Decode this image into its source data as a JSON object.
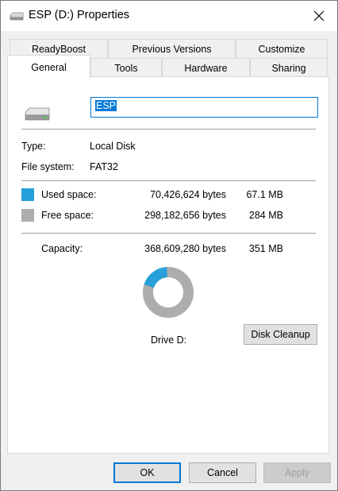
{
  "window": {
    "title": "ESP (D:) Properties"
  },
  "tabs_top": [
    "ReadyBoost",
    "Previous Versions",
    "Customize"
  ],
  "tabs_bottom": [
    "General",
    "Tools",
    "Hardware",
    "Sharing"
  ],
  "active_tab": "General",
  "drive": {
    "name": "ESP",
    "type_label": "Type:",
    "type_value": "Local Disk",
    "fs_label": "File system:",
    "fs_value": "FAT32"
  },
  "space": {
    "used_label": "Used space:",
    "used_bytes": "70,426,624 bytes",
    "used_size": "67.1 MB",
    "free_label": "Free space:",
    "free_bytes": "298,182,656 bytes",
    "free_size": "284 MB",
    "capacity_label": "Capacity:",
    "capacity_bytes": "368,609,280 bytes",
    "capacity_size": "351 MB",
    "used_fraction": 0.191,
    "used_color": "#26a0da",
    "free_color": "#adadad"
  },
  "drive_label": "Drive D:",
  "disk_cleanup_label": "Disk Cleanup",
  "buttons": {
    "ok": "OK",
    "cancel": "Cancel",
    "apply": "Apply"
  }
}
